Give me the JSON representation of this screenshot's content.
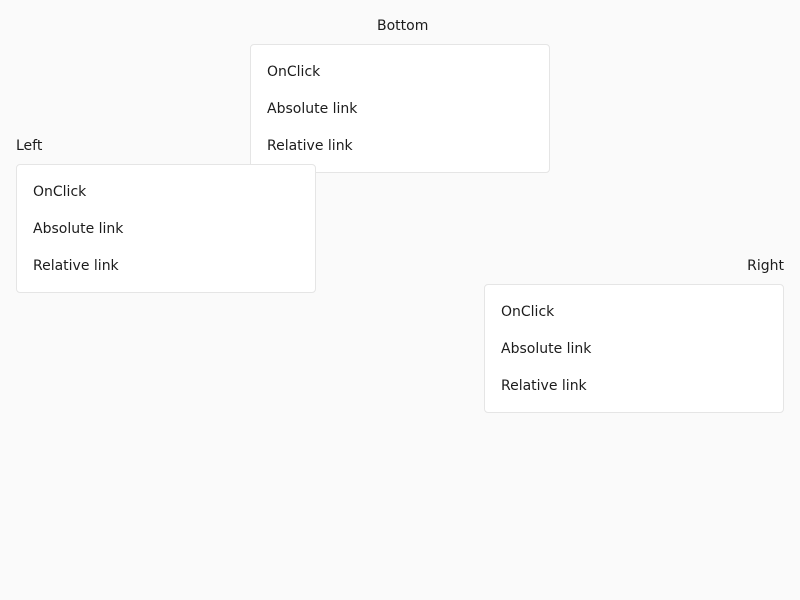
{
  "menus": {
    "bottom": {
      "trigger_label": "Bottom",
      "items": [
        "OnClick",
        "Absolute link",
        "Relative link"
      ]
    },
    "left": {
      "trigger_label": "Left",
      "items": [
        "OnClick",
        "Absolute link",
        "Relative link"
      ]
    },
    "right": {
      "trigger_label": "Right",
      "items": [
        "OnClick",
        "Absolute link",
        "Relative link"
      ]
    }
  }
}
